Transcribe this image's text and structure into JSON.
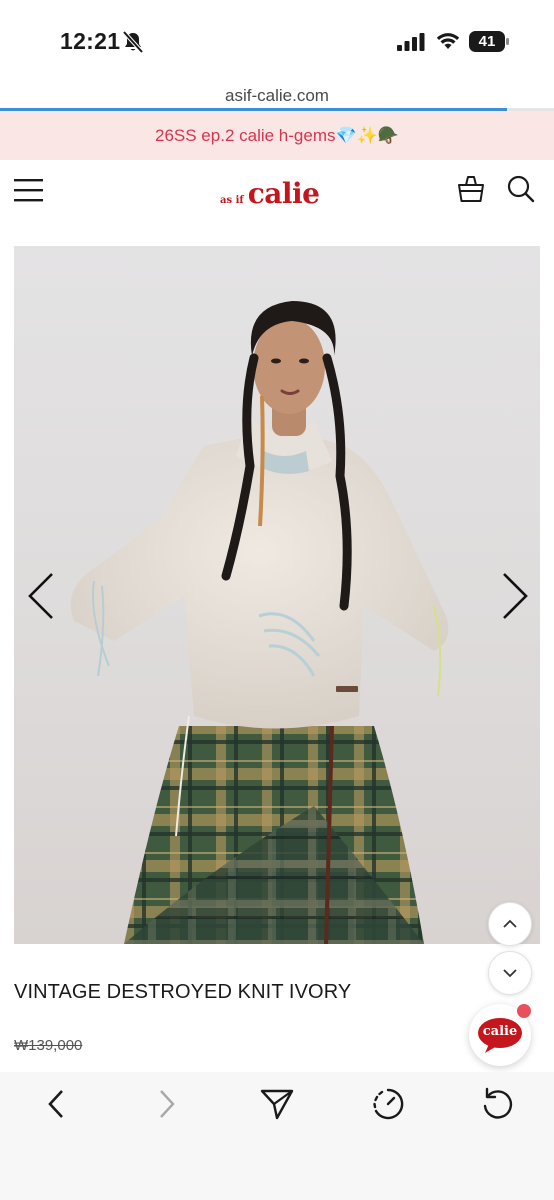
{
  "status_bar": {
    "time": "12:21",
    "battery": "41",
    "icons": [
      "bell-slash-icon",
      "cellular-signal-icon",
      "wifi-icon",
      "battery-icon"
    ]
  },
  "browser": {
    "url": "asif-calie.com",
    "load_progress": 0.915
  },
  "promo": {
    "text": "26SS ep.2 calie h-gems💎✨🪖"
  },
  "header": {
    "logo_small": "as if",
    "logo_big": "calie",
    "icons": [
      "menu-icon",
      "shopping-bag-icon",
      "search-icon"
    ]
  },
  "gallery": {
    "image_subject": "model in distressed ivory knit sweater and green plaid skirt",
    "icons": [
      "chevron-left-icon",
      "chevron-right-icon"
    ]
  },
  "product": {
    "name": "VINTAGE DESTROYED KNIT IVORY",
    "original_price": "₩139,000"
  },
  "floating": {
    "chat_label": "calie",
    "icons": [
      "scroll-up-icon",
      "scroll-down-icon",
      "chat-icon"
    ]
  },
  "toolbar": {
    "icons": [
      "back-icon",
      "forward-icon",
      "share-icon",
      "speed-dial-icon",
      "refresh-icon"
    ]
  },
  "colors": {
    "brand": "#c4161c",
    "promo_bg": "#fbe6e6",
    "promo_text": "#d9344e",
    "progress": "#3a8fd6"
  }
}
